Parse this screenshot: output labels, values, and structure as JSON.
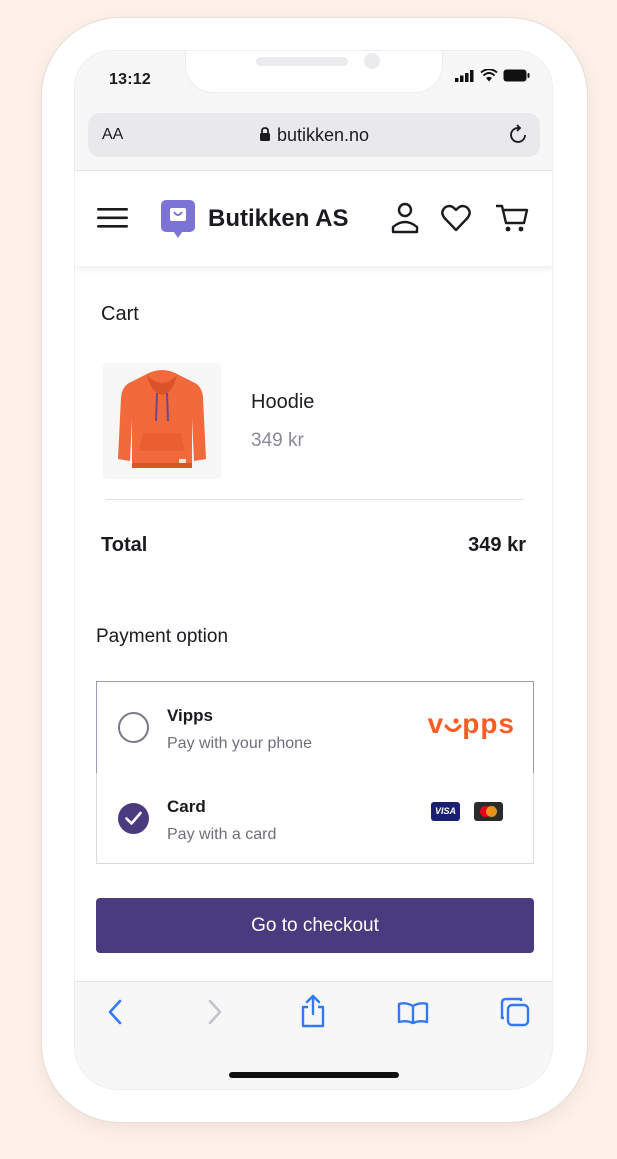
{
  "status_bar": {
    "time": "13:12"
  },
  "browser": {
    "text_size_label": "AA",
    "url": "butikken.no"
  },
  "site": {
    "brand_name": "Butikken AS"
  },
  "cart": {
    "title": "Cart",
    "items": [
      {
        "name": "Hoodie",
        "price": "349 kr"
      }
    ],
    "total_label": "Total",
    "total_value": "349 kr"
  },
  "payment": {
    "title": "Payment option",
    "options": [
      {
        "name": "Vipps",
        "description": "Pay with your phone",
        "selected": false,
        "logo_text": "vipps"
      },
      {
        "name": "Card",
        "description": "Pay with a card",
        "selected": true,
        "badge": "VISA"
      }
    ]
  },
  "checkout": {
    "button_label": "Go to checkout"
  },
  "colors": {
    "accent": "#4a3a7e",
    "vipps": "#ff5b24",
    "background": "#fdf1e9",
    "product": "#f26a3b"
  },
  "icons": [
    "menu-icon",
    "brand-logo-icon",
    "user-icon",
    "heart-icon",
    "cart-icon",
    "lock-icon",
    "reload-icon",
    "back-icon",
    "forward-icon",
    "share-icon",
    "bookmarks-icon",
    "tabs-icon"
  ]
}
